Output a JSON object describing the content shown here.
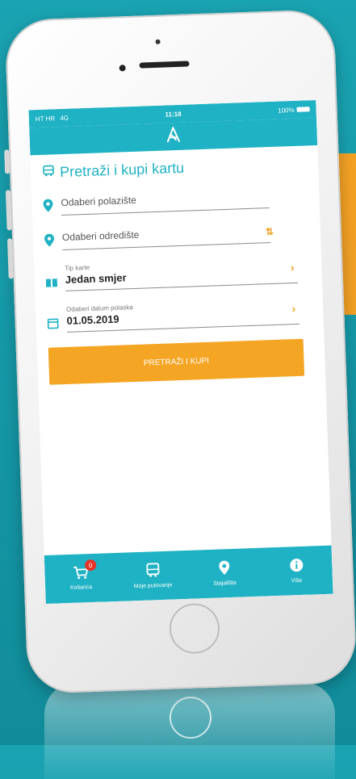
{
  "colors": {
    "background": "#1aa3b2",
    "accent": "#1fb2c4",
    "cta": "#f5a524",
    "badge": "#e5332a"
  },
  "status_bar": {
    "carrier": "HT HR",
    "network": "4G",
    "time": "11:18",
    "battery": "100%"
  },
  "header": {
    "logo_icon": "app-logo-icon"
  },
  "title": {
    "icon": "bus-icon",
    "text": "Pretraži i kupi kartu"
  },
  "form": {
    "origin": {
      "icon": "location-pin-icon",
      "placeholder": "Odaberi polazište"
    },
    "destination": {
      "icon": "location-pin-icon",
      "placeholder": "Odaberi odredište"
    },
    "swap_icon": "swap-arrows-icon",
    "ticket_type": {
      "icon": "ticket-icon",
      "label": "Tip karte",
      "value": "Jedan smjer"
    },
    "departure_date": {
      "icon": "calendar-icon",
      "label": "Odaberi datum polaska",
      "value": "01.05.2019"
    }
  },
  "cta": {
    "label": "PRETRAŽI I KUPI"
  },
  "tabs": [
    {
      "icon": "cart-icon",
      "label": "Košarica",
      "badge": "0"
    },
    {
      "icon": "bus-icon",
      "label": "Moje putovanje"
    },
    {
      "icon": "location-pin-icon",
      "label": "Stajališta"
    },
    {
      "icon": "info-icon",
      "label": "Više"
    }
  ]
}
